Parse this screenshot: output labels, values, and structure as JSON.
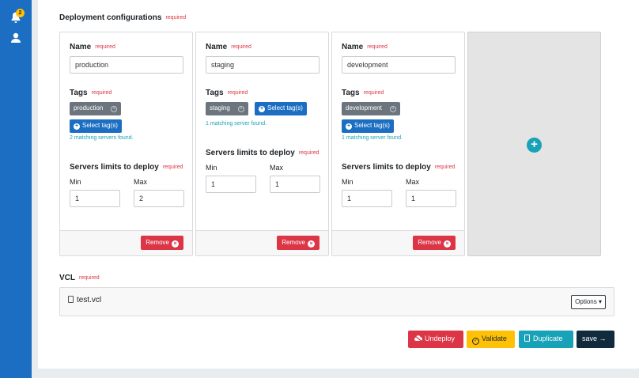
{
  "sidebar": {
    "notifications_count": "2"
  },
  "deployment": {
    "title": "Deployment configurations",
    "required": "required",
    "name_label": "Name",
    "tags_label": "Tags",
    "select_tags_label": "Select tag(s)",
    "limits_label": "Servers limits to deploy",
    "min_label": "Min",
    "max_label": "Max",
    "remove_label": "Remove",
    "cards": [
      {
        "name": "production",
        "tag": "production",
        "match": "2 matching servers found.",
        "min": "1",
        "max": "2"
      },
      {
        "name": "staging",
        "tag": "staging",
        "match": "1 matching server found.",
        "min": "1",
        "max": "1"
      },
      {
        "name": "development",
        "tag": "development",
        "match": "1 matching server found.",
        "min": "1",
        "max": "1"
      }
    ]
  },
  "vcl": {
    "title": "VCL",
    "required": "required",
    "file": "test.vcl",
    "options_label": "Options"
  },
  "actions": {
    "undeploy": "Undeploy",
    "validate": "Validate",
    "duplicate": "Duplicate",
    "save": "save"
  },
  "colors": {
    "primary": "#1b6ec2",
    "danger": "#dc3545",
    "warning": "#ffc107",
    "info": "#17a2b8",
    "dark": "#0f2b3d"
  }
}
